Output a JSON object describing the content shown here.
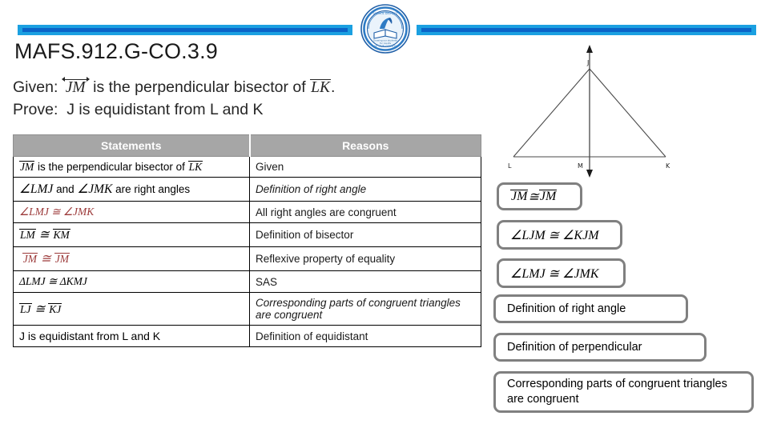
{
  "header": {
    "title": "MAFS.912.G-CO.3.9",
    "logo_alt": "school-district-seal",
    "bar_color_outer": "#1BA0E1",
    "bar_color_inner": "#0A64C8"
  },
  "prompt": {
    "given_prefix": "Given:",
    "given_segment": "JM",
    "given_middle": " is the perpendicular bisector of ",
    "given_segment2": "LK",
    "given_suffix": ".",
    "prove_prefix": "Prove:",
    "prove_text": "J is equidistant from L and K"
  },
  "table": {
    "columns": [
      "Statements",
      "Reasons"
    ],
    "header_bg": "#A6A6A6",
    "header_text_color": "#FFFFFF",
    "highlight_color": "#9C3A3A",
    "rows": [
      {
        "statement_pre": "",
        "statement_seg": "JM",
        "statement_mid": " is the perpendicular bisector of ",
        "statement_seg2": "LK",
        "statement_post": "",
        "statement_plain": "",
        "statement_red": false,
        "reason": "Given",
        "reason_red": false,
        "reason_italic": false
      },
      {
        "statement_math": "∠LMJ",
        "statement_mid_plain": " and ",
        "statement_math2": "∠JMK",
        "statement_tail_plain": " are right angles",
        "statement_red": false,
        "reason": "Definition of right angle",
        "reason_red": true,
        "reason_italic": true
      },
      {
        "statement_math": "∠LMJ ≅ ∠JMK",
        "statement_red": true,
        "reason": "All right angles are congruent",
        "reason_red": false,
        "reason_italic": false
      },
      {
        "statement_seg": "LM",
        "statement_mid": " ≅ ",
        "statement_seg2": "KM",
        "statement_red": false,
        "reason": "Definition of bisector",
        "reason_red": false,
        "reason_italic": false
      },
      {
        "statement_seg": "JM",
        "statement_mid": " ≅ ",
        "statement_seg2": "JM",
        "statement_red": true,
        "reason": "Reflexive property of equality",
        "reason_red": false,
        "reason_italic": false
      },
      {
        "statement_math": "ΔLMJ ≅ ΔKMJ",
        "statement_red": false,
        "reason": "SAS",
        "reason_red": false,
        "reason_italic": false
      },
      {
        "statement_seg": "LJ",
        "statement_mid": " ≅ ",
        "statement_seg2": "KJ",
        "statement_red": false,
        "reason": "Corresponding parts of congruent triangles are congruent",
        "reason_red": true,
        "reason_italic": true
      },
      {
        "statement_plain": "J is equidistant from L and K",
        "statement_red": false,
        "reason": "Definition of equidistant",
        "reason_red": false,
        "reason_italic": false
      }
    ]
  },
  "diagram": {
    "name": "triangle-JLK-with-perpendicular-bisector",
    "vertex_labels": [
      "J",
      "L",
      "M",
      "K"
    ],
    "label_J": "J",
    "label_L": "L",
    "label_M": "M",
    "label_K": "K"
  },
  "answer_boxes": [
    {
      "id": "box-jm",
      "kind": "math",
      "seg": "JM",
      "mid": " ≅ ",
      "seg2": "JM"
    },
    {
      "id": "box-ljm",
      "kind": "math",
      "text": "∠LJM ≅ ∠KJM"
    },
    {
      "id": "box-lmj",
      "kind": "math",
      "text": "∠LMJ ≅ ∠JMK"
    },
    {
      "id": "box-dra",
      "kind": "text",
      "text": "Definition of right angle"
    },
    {
      "id": "box-dperp",
      "kind": "text",
      "text": "Definition of perpendicular"
    },
    {
      "id": "box-cpctc",
      "kind": "text",
      "text": "Corresponding parts of congruent triangles are congruent"
    }
  ],
  "answer_box_border_color": "#808080"
}
